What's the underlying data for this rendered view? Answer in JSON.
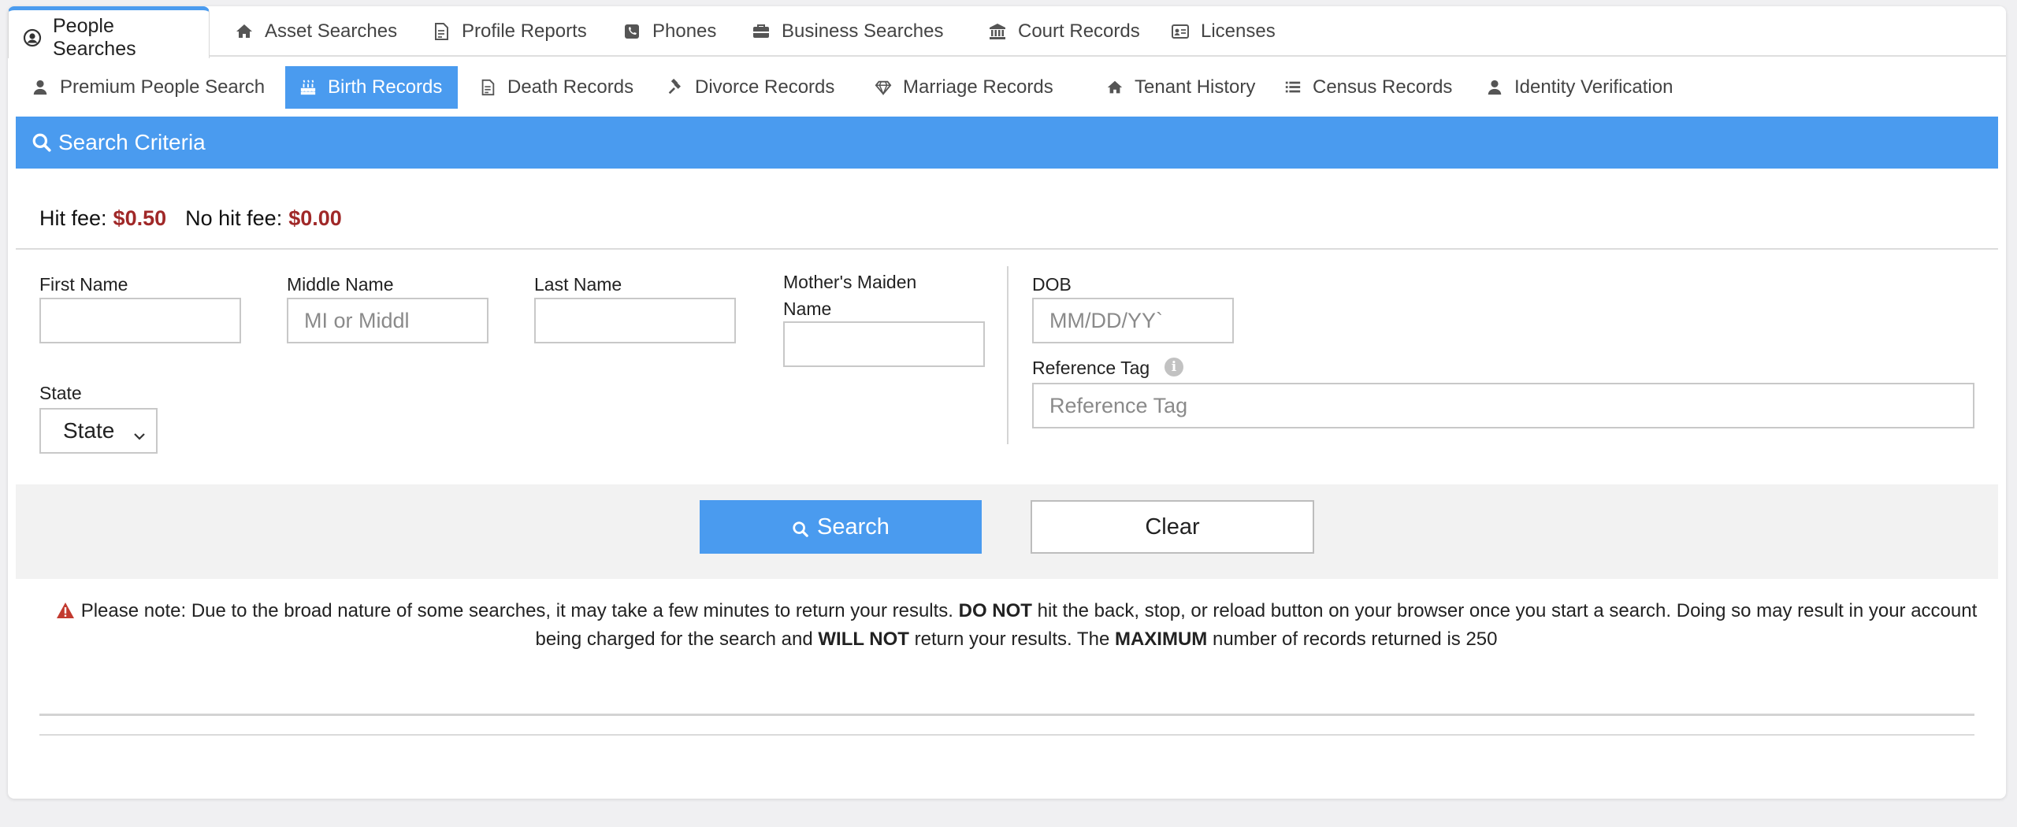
{
  "top_tabs": [
    {
      "label": "People Searches",
      "icon": "user-circle-icon",
      "active": true
    },
    {
      "label": "Asset Searches",
      "icon": "home-icon"
    },
    {
      "label": "Profile Reports",
      "icon": "document-icon"
    },
    {
      "label": "Phones",
      "icon": "phone-icon"
    },
    {
      "label": "Business Searches",
      "icon": "briefcase-icon"
    },
    {
      "label": "Court Records",
      "icon": "bank-icon"
    },
    {
      "label": "Licenses",
      "icon": "id-card-icon"
    }
  ],
  "sub_tabs": [
    {
      "label": "Premium People Search",
      "icon": "user-icon"
    },
    {
      "label": "Birth Records",
      "icon": "birthday-cake-icon",
      "active": true
    },
    {
      "label": "Death Records",
      "icon": "document-icon"
    },
    {
      "label": "Divorce Records",
      "icon": "gavel-icon"
    },
    {
      "label": "Marriage Records",
      "icon": "diamond-icon"
    },
    {
      "label": "Tenant History",
      "icon": "home-icon"
    },
    {
      "label": "Census Records",
      "icon": "list-icon"
    },
    {
      "label": "Identity Verification",
      "icon": "user-icon"
    }
  ],
  "panel": {
    "title": "Search Criteria",
    "hit_fee_label": "Hit fee:",
    "hit_fee_value": "$0.50",
    "no_hit_fee_label": "No hit fee:",
    "no_hit_fee_value": "$0.00"
  },
  "form": {
    "first_name": {
      "label": "First Name",
      "value": "",
      "placeholder": ""
    },
    "middle_name": {
      "label": "Middle Name",
      "value": "",
      "placeholder": "MI or Middl"
    },
    "last_name": {
      "label": "Last Name",
      "value": "",
      "placeholder": ""
    },
    "mothers_maiden_name": {
      "label": "Mother's Maiden Name",
      "value": "",
      "placeholder": ""
    },
    "dob": {
      "label": "DOB",
      "value": "",
      "placeholder": "MM/DD/YY`"
    },
    "reference_tag": {
      "label": "Reference Tag",
      "value": "",
      "placeholder": "Reference Tag"
    },
    "state": {
      "label": "State",
      "selected": "State"
    }
  },
  "buttons": {
    "search": "Search",
    "clear": "Clear"
  },
  "notice": {
    "part1": "Please note: Due to the broad nature of some searches, it may take a few minutes to return your results.",
    "do_not": "DO NOT",
    "part2": "hit the back, stop, or reload button on your browser once you start a search. Doing so may result in your account being charged for the search and",
    "will_not": "WILL NOT",
    "part3": "return your results. The",
    "maximum": "MAXIMUM",
    "part4": "number of records returned is 250"
  },
  "colors": {
    "accent": "#4a9bef",
    "fee": "#a02828",
    "warning": "#c23a2f"
  }
}
